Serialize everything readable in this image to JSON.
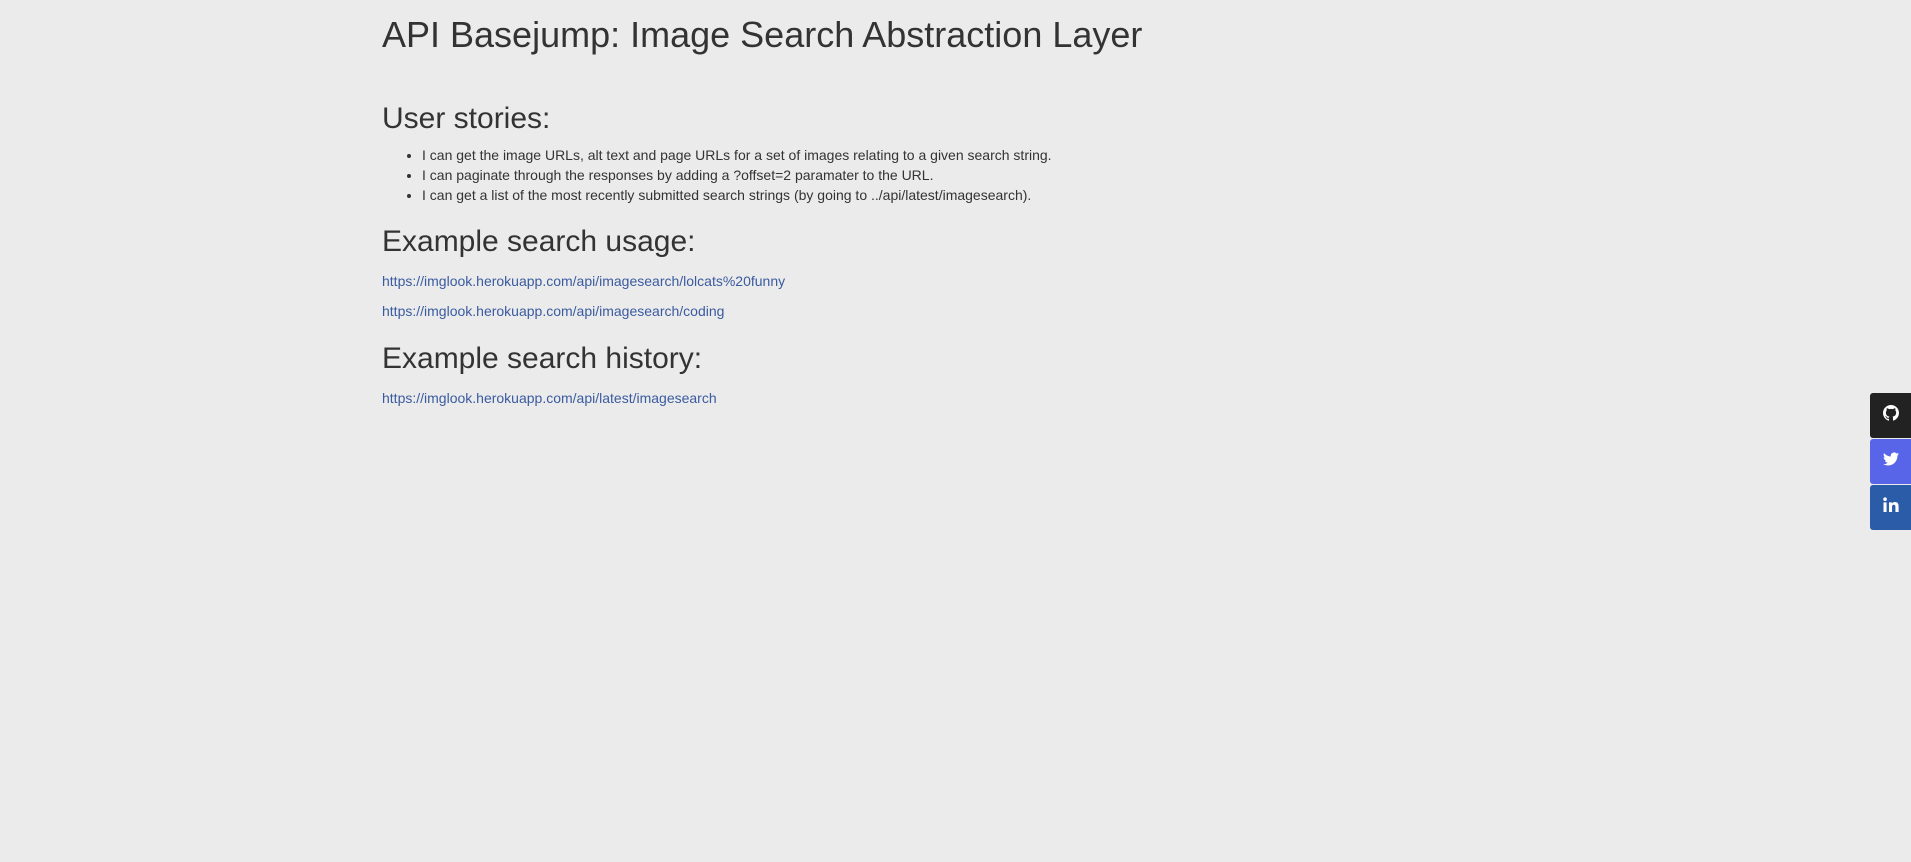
{
  "header": {
    "title": "API Basejump: Image Search Abstraction Layer"
  },
  "user_stories": {
    "heading": "User stories:",
    "items": [
      "I can get the image URLs, alt text and page URLs for a set of images relating to a given search string.",
      "I can paginate through the responses by adding a ?offset=2 paramater to the URL.",
      "I can get a list of the most recently submitted search strings (by going to ../api/latest/imagesearch)."
    ]
  },
  "search_usage": {
    "heading": "Example search usage:",
    "links": [
      "https://imglook.herokuapp.com/api/imagesearch/lolcats%20funny",
      "https://imglook.herokuapp.com/api/imagesearch/coding"
    ]
  },
  "search_history": {
    "heading": "Example search history:",
    "links": [
      "https://imglook.herokuapp.com/api/latest/imagesearch"
    ]
  },
  "social": {
    "buttons": [
      {
        "icon": "github-icon",
        "color": "#222222"
      },
      {
        "icon": "twitter-icon",
        "color": "#5865e8"
      },
      {
        "icon": "linkedin-icon",
        "color": "#2a5ca8"
      }
    ]
  }
}
